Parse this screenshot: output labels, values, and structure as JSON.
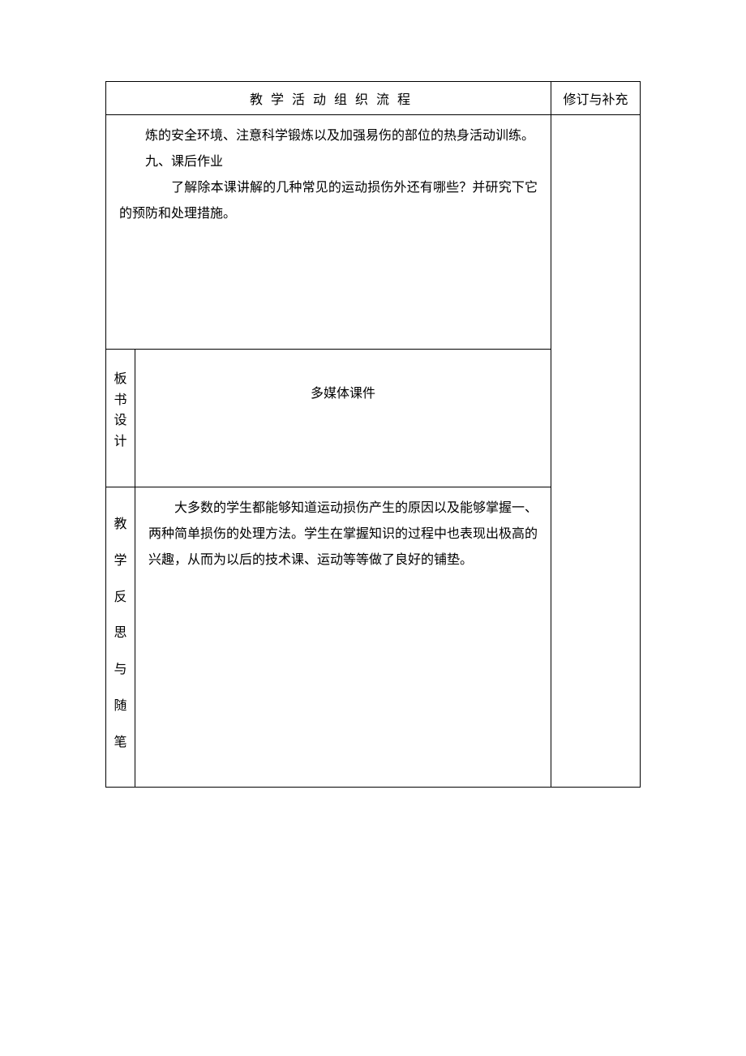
{
  "header": {
    "main_title": "教学活动组织流程",
    "sidebar_title": "修订与补充"
  },
  "row1": {
    "p1": "炼的安全环境、注意科学锻炼以及加强易伤的部位的热身活动训练。",
    "p2": "九、课后作业",
    "p3": "了解除本课讲解的几种常见的运动损伤外还有哪些？并研究下它的预防和处理措施。"
  },
  "row2": {
    "label": "板书设计",
    "content": "多媒体课件"
  },
  "row3": {
    "label": "教学反思与随笔",
    "content": "大多数的学生都能够知道运动损伤产生的原因以及能够掌握一、两种简单损伤的处理方法。学生在掌握知识的过程中也表现出极高的兴趣，从而为以后的技术课、运动等等做了良好的铺垫。"
  }
}
